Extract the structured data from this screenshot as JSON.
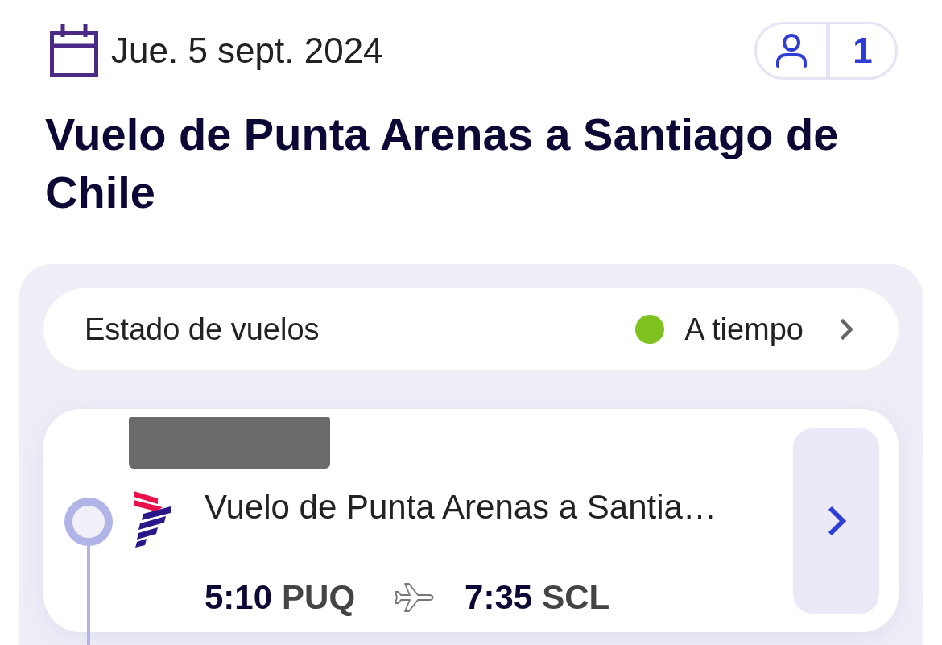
{
  "header": {
    "date": "Jue. 5 sept. 2024",
    "passengers": "1"
  },
  "title": "Vuelo de Punta Arenas a Santiago de Chile",
  "flight_status": {
    "label": "Estado de vuelos",
    "status": "A tiempo",
    "color": "#7dc21e"
  },
  "flights": [
    {
      "title": "Vuelo de Punta Arenas a Santia…",
      "departure_time": "5:10",
      "departure_airport": "PUQ",
      "arrival_time": "7:35",
      "arrival_airport": "SCL"
    }
  ]
}
